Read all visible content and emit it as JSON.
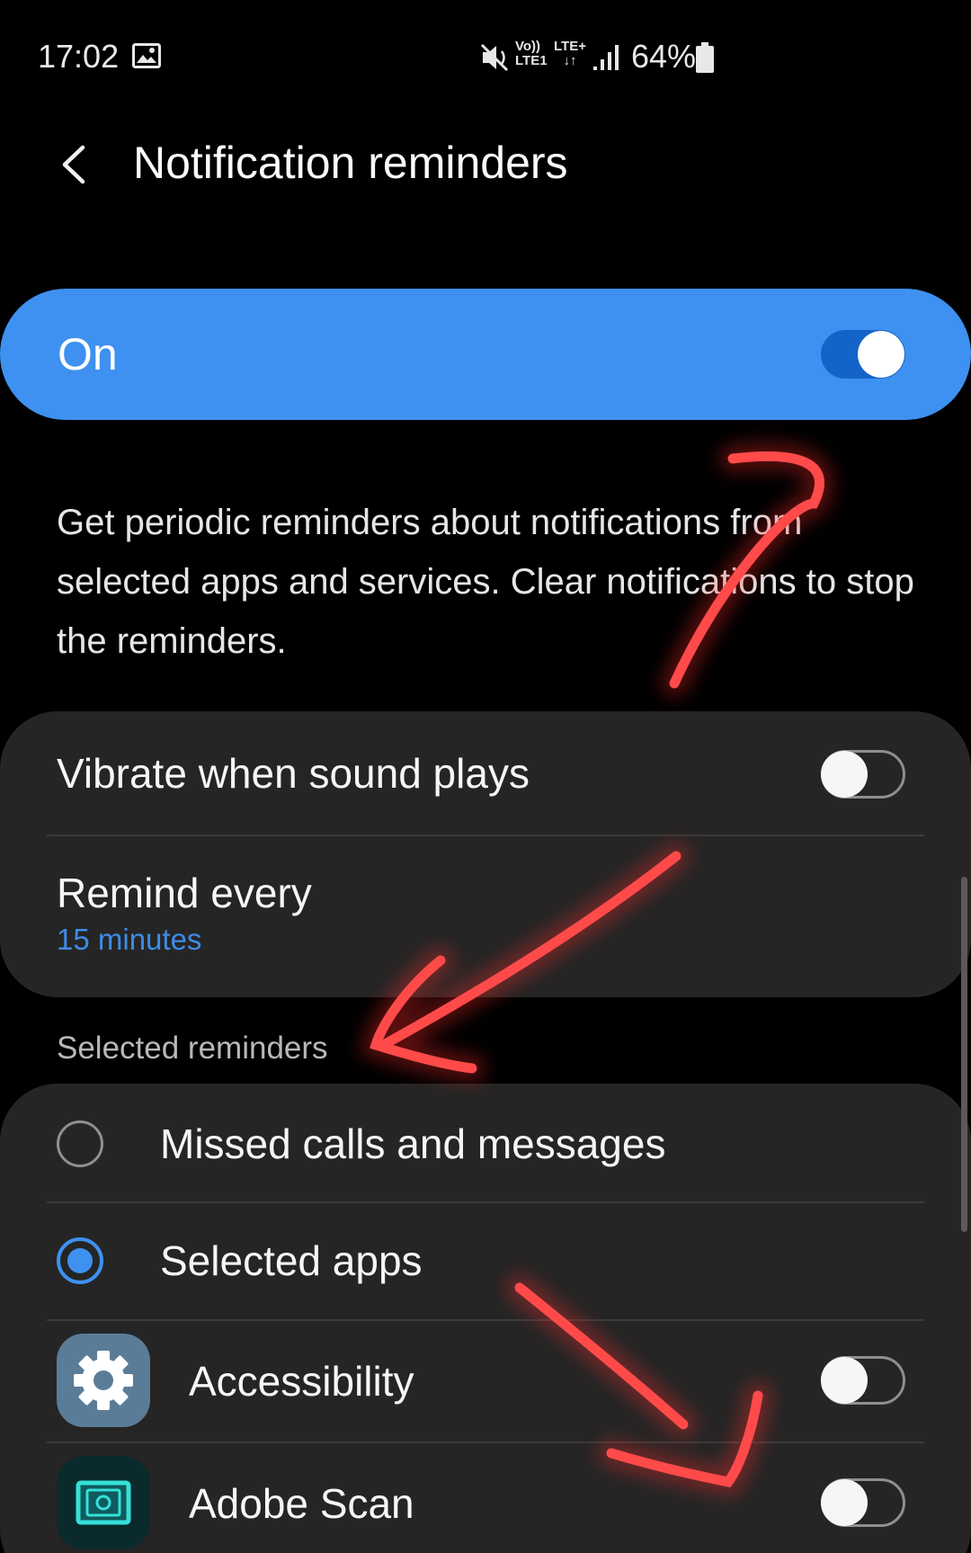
{
  "status_bar": {
    "time": "17:02",
    "volte_top": "Vo))",
    "volte_bottom": "LTE1",
    "network": "LTE+",
    "data_arrows": "↓↑",
    "battery_percent": "64%",
    "icons": [
      "gallery-icon",
      "mute-icon",
      "signal-icon",
      "battery-icon"
    ]
  },
  "header": {
    "title": "Notification reminders",
    "back_icon": "chevron-left-icon"
  },
  "master_toggle": {
    "label": "On",
    "enabled": true
  },
  "description": "Get periodic reminders about notifications from selected apps and services. Clear notifications to stop the reminders.",
  "settings": {
    "vibrate": {
      "label": "Vibrate when sound plays",
      "enabled": false
    },
    "remind_every": {
      "label": "Remind every",
      "value": "15 minutes"
    }
  },
  "selected_reminders": {
    "header": "Selected reminders",
    "options": [
      {
        "label": "Missed calls and messages",
        "checked": false
      },
      {
        "label": "Selected apps",
        "checked": true
      }
    ],
    "apps": [
      {
        "name": "Accessibility",
        "icon": "gear-icon",
        "enabled": false
      },
      {
        "name": "Adobe Scan",
        "icon": "adobe-scan-icon",
        "enabled": false
      }
    ]
  },
  "colors": {
    "accent": "#3e91f0",
    "switch_on_track": "#1463c8",
    "card_background": "#252525",
    "page_background": "#000000",
    "sub_value": "#3d8ce6",
    "annotation_red": "#ff3a3a"
  }
}
